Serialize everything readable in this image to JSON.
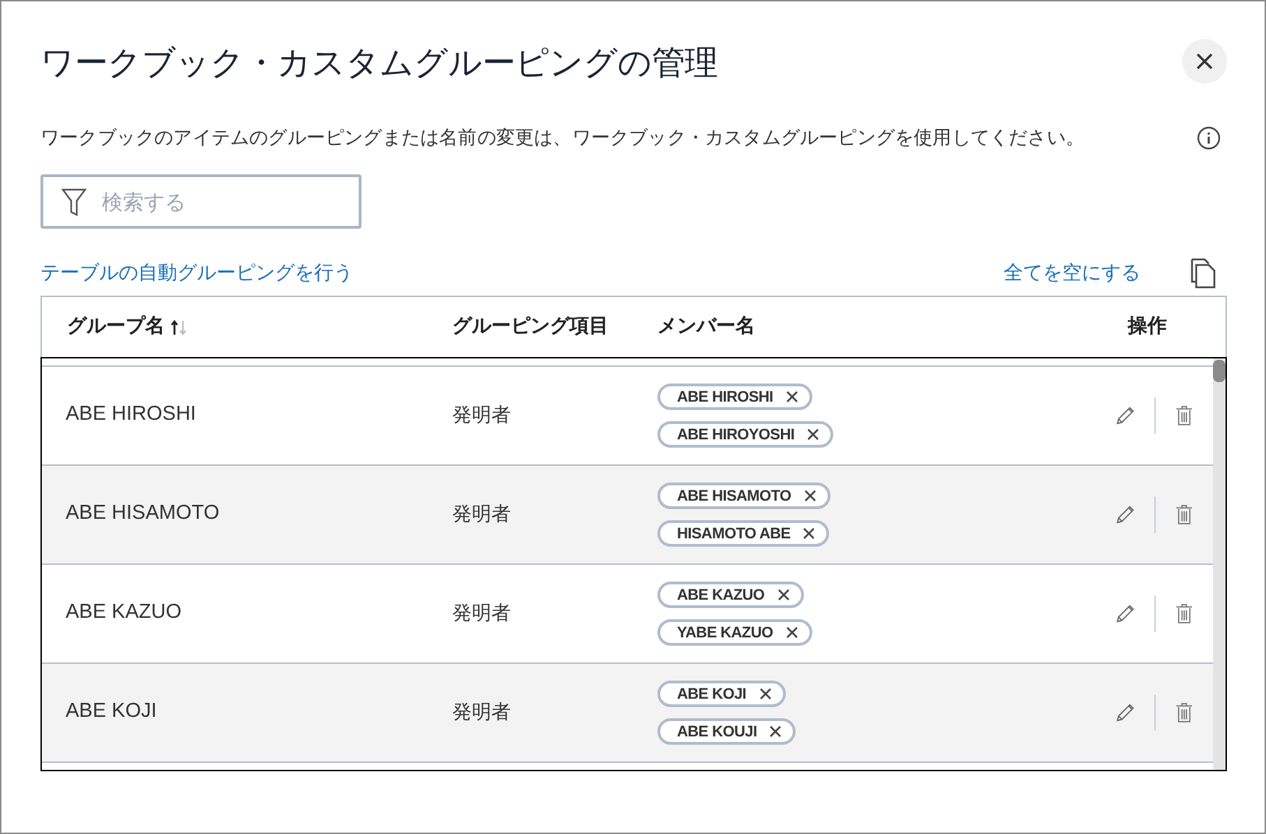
{
  "dialog": {
    "title": "ワークブック・カスタムグルーピングの管理",
    "description": "ワークブックのアイテムのグルーピングまたは名前の変更は、ワークブック・カスタムグルーピングを使用してください。"
  },
  "search": {
    "placeholder": "検索する"
  },
  "actions": {
    "auto_group_link": "テーブルの自動グルーピングを行う",
    "clear_all_link": "全てを空にする"
  },
  "table": {
    "columns": [
      "グループ名",
      "グルーピング項目",
      "メンバー名",
      "操作"
    ],
    "rows": [
      {
        "group": "ABE HIROSHI",
        "item": "発明者",
        "members": [
          "ABE HIROSHI",
          "ABE HIROYOSHI"
        ]
      },
      {
        "group": "ABE HISAMOTO",
        "item": "発明者",
        "members": [
          "ABE HISAMOTO",
          "HISAMOTO ABE"
        ]
      },
      {
        "group": "ABE KAZUO",
        "item": "発明者",
        "members": [
          "ABE KAZUO",
          "YABE KAZUO"
        ]
      },
      {
        "group": "ABE KOJI",
        "item": "発明者",
        "members": [
          "ABE KOJI",
          "ABE KOUJI"
        ]
      }
    ]
  }
}
